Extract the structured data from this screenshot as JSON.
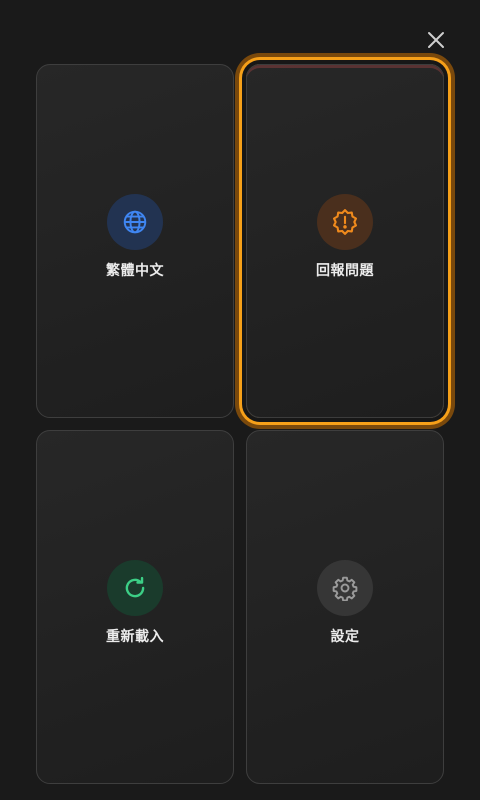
{
  "menu": {
    "items": [
      {
        "label": "繁體中文",
        "icon": "globe-icon",
        "color": "#3f86f2",
        "selected": false
      },
      {
        "label": "回報問題",
        "icon": "warning-badge-icon",
        "color": "#f08a1c",
        "selected": true
      },
      {
        "label": "重新載入",
        "icon": "reload-icon",
        "color": "#3ccf86",
        "selected": false
      },
      {
        "label": "設定",
        "icon": "gear-icon",
        "color": "#9a9a9a",
        "selected": false
      }
    ]
  },
  "colors": {
    "background": "#1a1a1a",
    "focus_ring": "#f6a019"
  }
}
